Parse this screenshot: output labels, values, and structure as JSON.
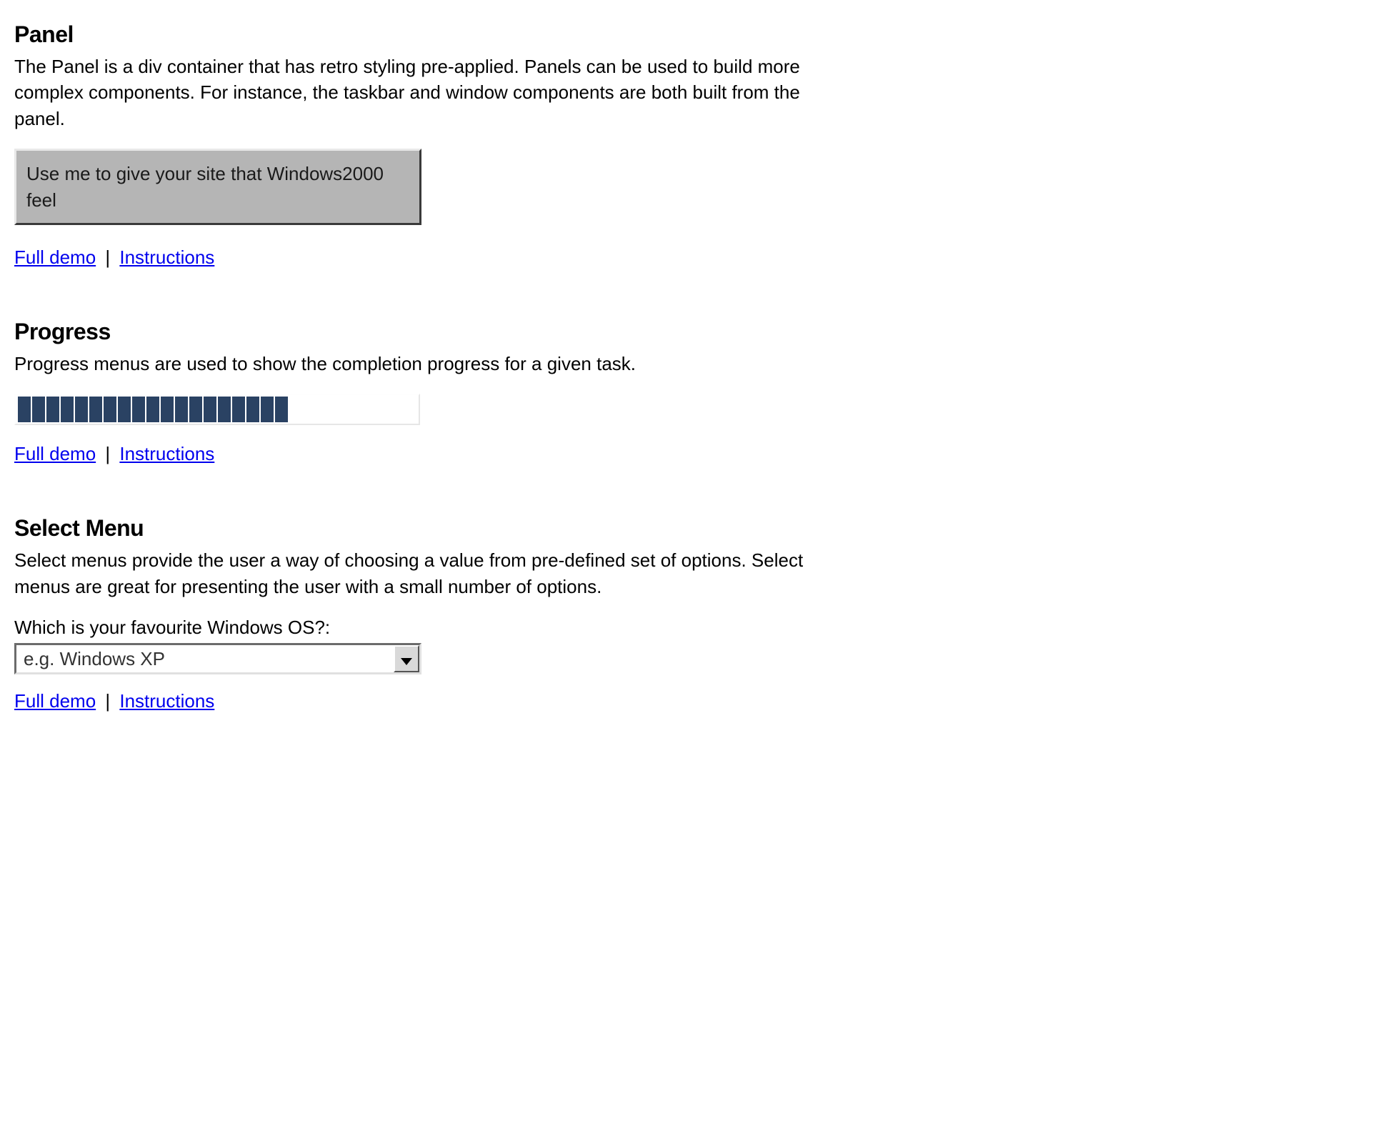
{
  "panel": {
    "heading": "Panel",
    "description": "The Panel is a div container that has retro styling pre-applied. Panels can be used to build more complex components. For instance, the taskbar and window components are both built from the panel.",
    "demo_text": "Use me to give your site that Windows2000 feel",
    "link_full_demo": "Full demo",
    "link_instructions": "Instructions"
  },
  "progress": {
    "heading": "Progress",
    "description": "Progress menus are used to show the completion progress for a given task.",
    "total_blocks": 28,
    "filled_blocks": 19,
    "link_full_demo": "Full demo",
    "link_instructions": "Instructions"
  },
  "select": {
    "heading": "Select Menu",
    "description": "Select menus provide the user a way of choosing a value from pre-defined set of options. Select menus are great for presenting the user with a small number of options.",
    "label": "Which is your favourite Windows OS?:",
    "placeholder": "e.g. Windows XP",
    "link_full_demo": "Full demo",
    "link_instructions": "Instructions"
  },
  "colors": {
    "progress_fill": "#2a4263",
    "panel_bg": "#b5b5b5",
    "link": "#0000EE"
  }
}
